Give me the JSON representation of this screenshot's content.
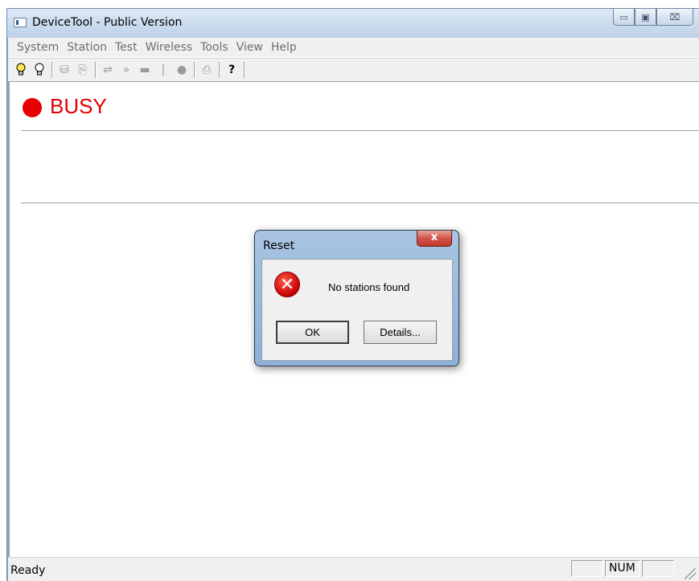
{
  "window": {
    "title": "DeviceTool - Public Version",
    "caption_buttons": [
      "minimize-icon",
      "maximize-icon",
      "close-icon"
    ],
    "caption_glyphs": {
      "minimize": "▭",
      "maximize": "▣",
      "close": "⌧"
    }
  },
  "menubar": {
    "items": [
      "System",
      "Station",
      "Test",
      "Wireless",
      "Tools",
      "View",
      "Help"
    ]
  },
  "toolbar": {
    "glyphs": {
      "bulb_on": "💡",
      "bulb_off": "💡",
      "connect": "⛁",
      "document": "⎘",
      "sync": "⇌",
      "forward": "»",
      "device": "▬",
      "bar": "|",
      "record": "●",
      "print": "⎙",
      "help": "?"
    }
  },
  "status_indicator": {
    "label": "BUSY",
    "color": "#e60000"
  },
  "statusbar": {
    "text": "Ready",
    "panes": [
      "",
      "NUM",
      ""
    ]
  },
  "dialog": {
    "title": "Reset",
    "close_glyph": "x",
    "icon": "error-icon",
    "icon_glyph": "✕",
    "message": "No stations found",
    "buttons": {
      "ok": "OK",
      "details": "Details..."
    }
  }
}
